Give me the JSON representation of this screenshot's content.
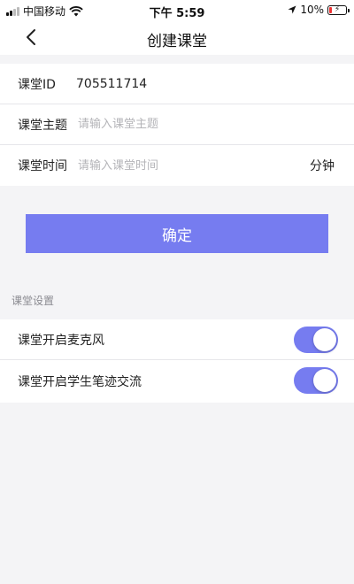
{
  "status_bar": {
    "carrier": "中国移动",
    "time": "下午 5:59",
    "battery": "10%"
  },
  "nav": {
    "title": "创建课堂",
    "back_icon": "chevron-left-icon"
  },
  "form": {
    "class_id_label": "课堂ID",
    "class_id_value": "705511714",
    "topic_label": "课堂主题",
    "topic_placeholder": "请输入课堂主题",
    "duration_label": "课堂时间",
    "duration_placeholder": "请输入课堂时间",
    "duration_unit": "分钟"
  },
  "confirm_label": "确定",
  "settings": {
    "section_title": "课堂设置",
    "items": [
      {
        "label": "课堂开启麦克风",
        "enabled": true
      },
      {
        "label": "课堂开启学生笔迹交流",
        "enabled": true
      }
    ]
  },
  "colors": {
    "accent": "#767cf0",
    "background": "#f4f4f6"
  }
}
